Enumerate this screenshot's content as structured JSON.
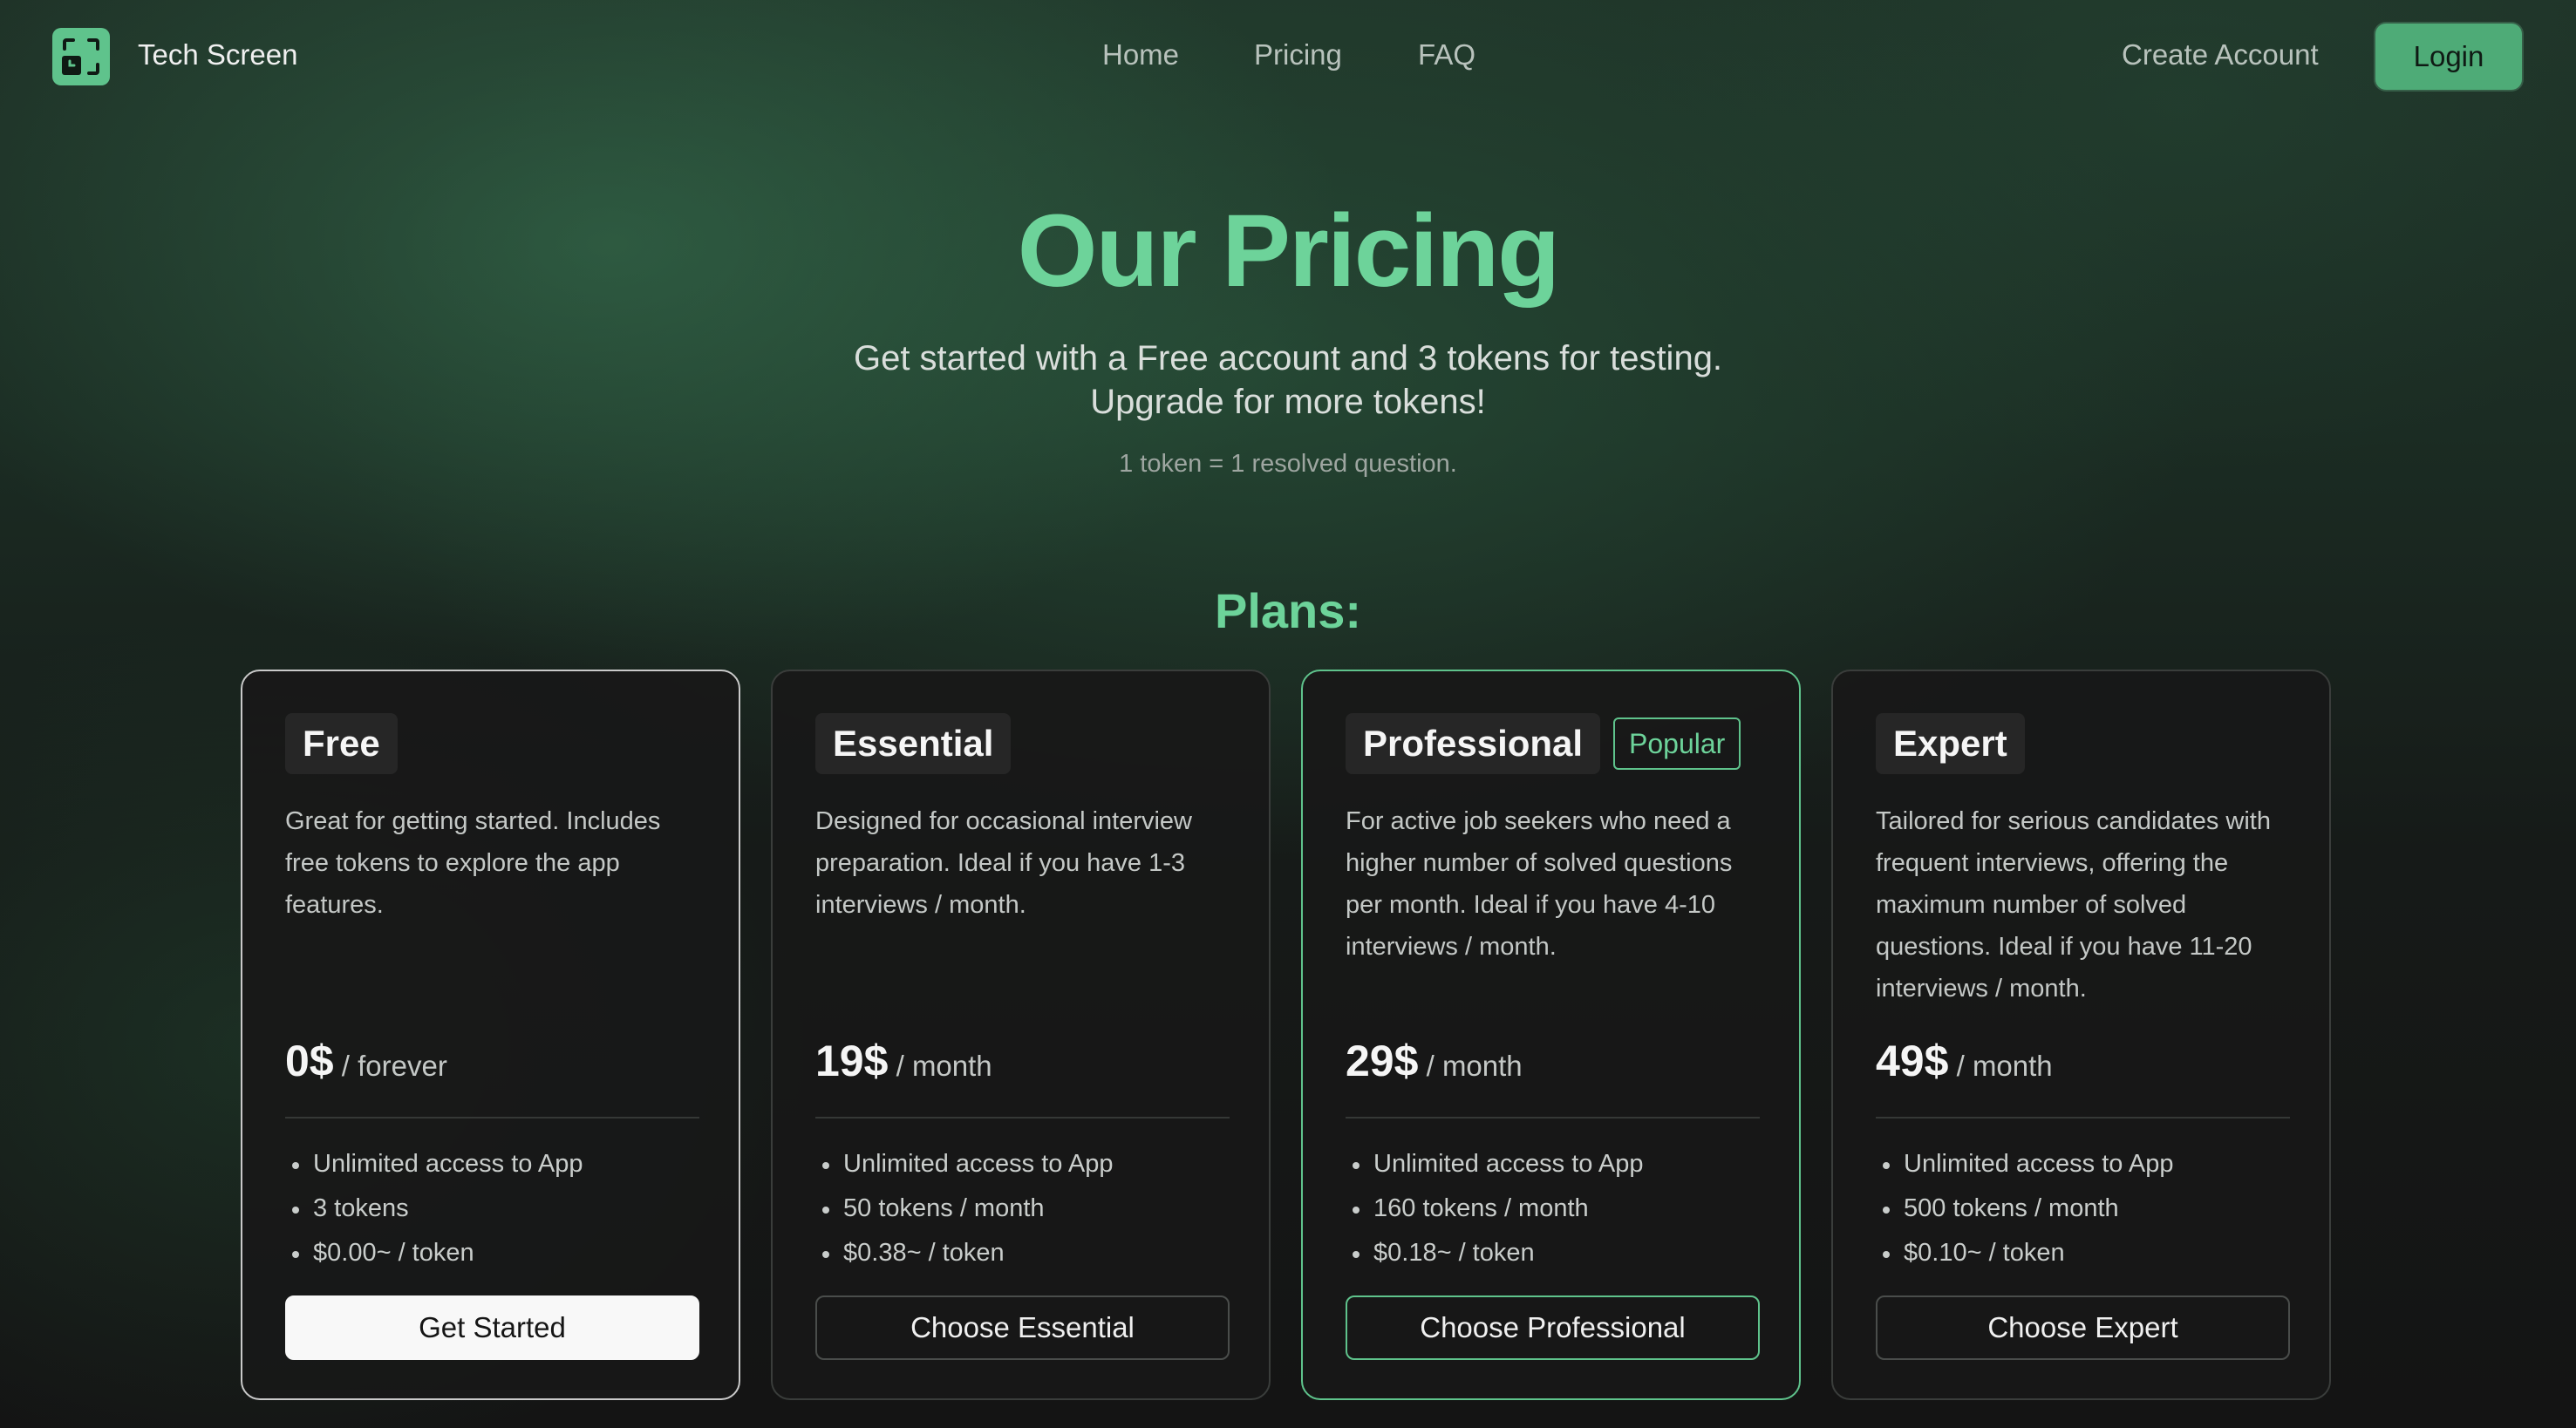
{
  "header": {
    "brand": "Tech Screen",
    "nav": [
      "Home",
      "Pricing",
      "FAQ"
    ],
    "create_account": "Create Account",
    "login": "Login"
  },
  "hero": {
    "title": "Our Pricing",
    "subtitle_line1": "Get started with a Free account and 3 tokens for testing.",
    "subtitle_line2": "Upgrade for more tokens!",
    "note": "1 token = 1 resolved question.",
    "plans_title": "Plans:"
  },
  "plans": [
    {
      "name": "Free",
      "description": "Great for getting started. Includes free tokens to explore the app features.",
      "price": "0$",
      "period": "/ forever",
      "features": [
        "Unlimited access to App",
        "3 tokens",
        "$0.00~ / token"
      ],
      "button": "Get Started"
    },
    {
      "name": "Essential",
      "description": "Designed for occasional interview preparation. Ideal if you have 1-3 interviews / month.",
      "price": "19$",
      "period": "/ month",
      "features": [
        "Unlimited access to App",
        "50 tokens / month",
        "$0.38~ / token"
      ],
      "button": "Choose Essential"
    },
    {
      "name": "Professional",
      "badge": "Popular",
      "description": "For active job seekers who need a higher number of solved questions per month. Ideal if you have 4-10 interviews / month.",
      "price": "29$",
      "period": "/ month",
      "features": [
        "Unlimited access to App",
        "160 tokens / month",
        "$0.18~ / token"
      ],
      "button": "Choose Professional"
    },
    {
      "name": "Expert",
      "description": "Tailored for serious candidates with frequent interviews, offering the maximum number of solved questions. Ideal if you have 11-20 interviews / month.",
      "price": "49$",
      "period": "/ month",
      "features": [
        "Unlimited access to App",
        "500 tokens / month",
        "$0.10~ / token"
      ],
      "button": "Choose Expert"
    }
  ],
  "colors": {
    "accent": "#6dd39a",
    "button_green": "#4eab77",
    "background": "#151515"
  },
  "icons": {
    "logo": "scan-frame-icon"
  }
}
